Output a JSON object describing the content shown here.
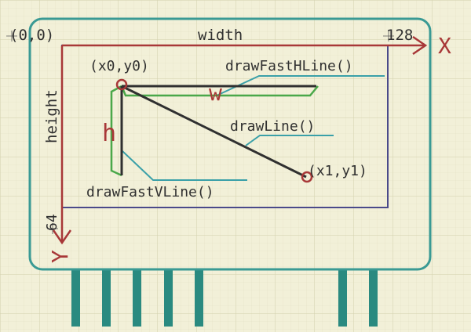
{
  "labels": {
    "origin": "(0,0)",
    "width": "width",
    "x_max": "128",
    "x_axis": "X",
    "height": "height",
    "y_max": "64",
    "y_axis": "Y",
    "start_point": "(x0,y0)",
    "end_point": "(x1,y1)",
    "fast_hline": "drawFastHLine()",
    "fast_vline": "drawFastVLine()",
    "line": "drawLine()",
    "w": "w",
    "h": "h"
  },
  "colors": {
    "background": "#f2f0d8",
    "grid": "#dcdab8",
    "board": "#3a9a94",
    "pins": "#2a8a80",
    "axis": "#a83838",
    "display": "#4a4a8a",
    "leader": "#3aa0a8",
    "green": "#4aa84a",
    "line": "#303030",
    "text": "#303030"
  }
}
